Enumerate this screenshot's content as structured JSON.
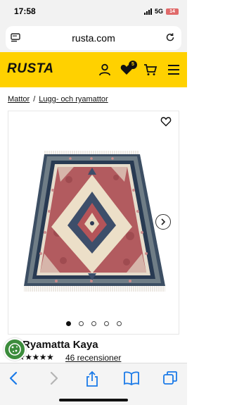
{
  "status_bar": {
    "time": "17:58",
    "network": "5G",
    "battery": "14"
  },
  "browser": {
    "url": "rusta.com"
  },
  "header": {
    "logo": "RUSTA",
    "cart_badge": "5"
  },
  "breadcrumb": {
    "items": [
      "Mattor",
      "Lugg- och ryamattor"
    ],
    "separator": "/"
  },
  "gallery": {
    "image_count": 5,
    "active_index": 0
  },
  "product": {
    "title": "Ryamatta Kaya",
    "rating_stars": "★★★★★",
    "reviews": "46 recensioner"
  },
  "colors": {
    "brand_yellow": "#ffd100",
    "cookie_green": "#3c8c3c",
    "link_blue": "#1a7ae8"
  },
  "icons": [
    "tabs-list-icon",
    "reload-icon",
    "user-icon",
    "heart-icon",
    "cart-icon",
    "menu-icon",
    "favorite-icon",
    "chevron-right-icon",
    "cookie-icon",
    "back-icon",
    "forward-icon",
    "share-icon",
    "bookmarks-icon",
    "tabs-icon"
  ]
}
